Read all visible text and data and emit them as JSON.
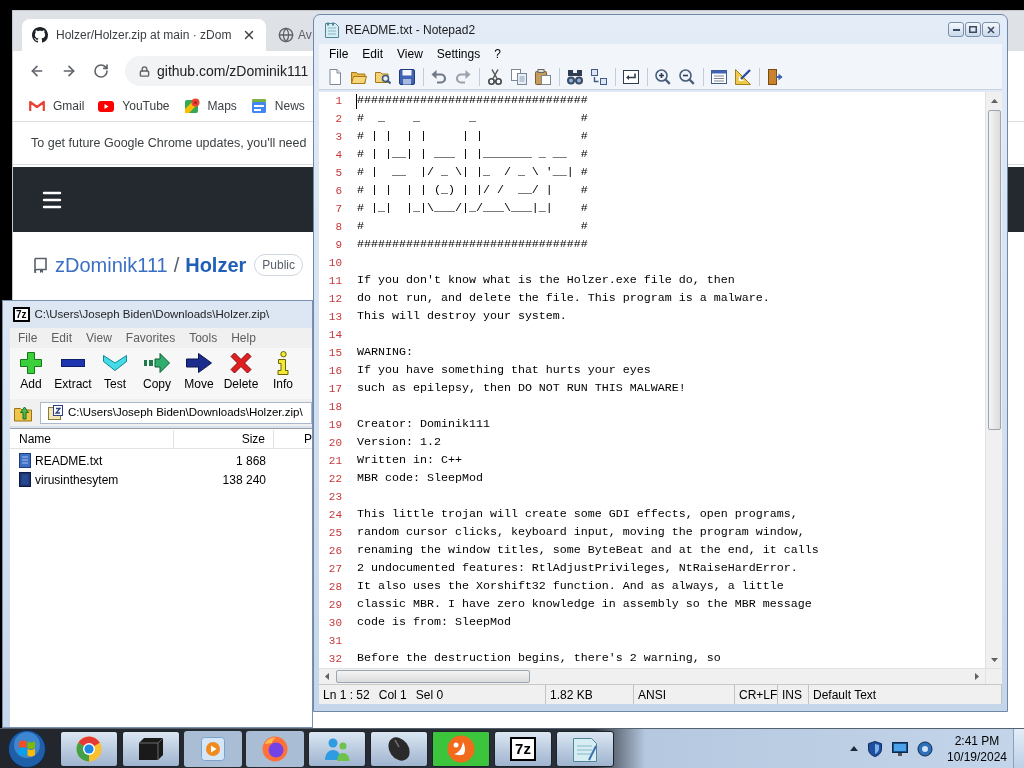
{
  "browser": {
    "tabs": [
      {
        "kind": "cat-logo",
        "title": "Holzer/Holzer.zip at main · zDom",
        "selected": true
      },
      {
        "kind": "globe",
        "title": "Av",
        "selected": false
      }
    ],
    "address": "github.com/zDominik111",
    "bookmarks": [
      {
        "kind": "mail",
        "label": "Gmail"
      },
      {
        "kind": "video",
        "label": "YouTube"
      },
      {
        "kind": "maps",
        "label": "Maps"
      },
      {
        "kind": "news",
        "label": "News"
      }
    ],
    "notice": "To get future Google Chrome updates, you'll need",
    "repo": {
      "owner": "zDominik111",
      "separator": "/",
      "name": "Holzer",
      "visibility": "Public"
    }
  },
  "archive": {
    "logo": "7z",
    "title": "C:\\Users\\Joseph Biden\\Downloads\\Holzer.zip\\",
    "menu": [
      "File",
      "Edit",
      "View",
      "Favorites",
      "Tools",
      "Help"
    ],
    "toolbar": [
      {
        "kind": "add",
        "label": "Add"
      },
      {
        "kind": "extract",
        "label": "Extract"
      },
      {
        "kind": "test",
        "label": "Test"
      },
      {
        "kind": "copy",
        "label": "Copy"
      },
      {
        "kind": "move",
        "label": "Move"
      },
      {
        "kind": "delete",
        "label": "Delete"
      },
      {
        "kind": "info",
        "label": "Info"
      }
    ],
    "path": "C:\\Users\\Joseph Biden\\Downloads\\Holzer.zip\\",
    "columns": [
      "Name",
      "Size",
      "P"
    ],
    "rows": [
      {
        "kind": "text",
        "name": "README.txt",
        "size": "1 868"
      },
      {
        "kind": "binary",
        "name": "virusinthesytem",
        "size": "138 240"
      }
    ]
  },
  "editor": {
    "title": "README.txt - Notepad2",
    "menu": [
      "File",
      "Edit",
      "View",
      "Settings",
      "?"
    ],
    "lines": [
      {
        "number": "1",
        "text": "#################################",
        "caret": true
      },
      {
        "number": "2",
        "text": "#  _    _       _               #",
        "caret": false
      },
      {
        "number": "3",
        "text": "# | |  | |     | |              #",
        "caret": false
      },
      {
        "number": "4",
        "text": "# | |__| | ___ | |_______ _ __  #",
        "caret": false
      },
      {
        "number": "5",
        "text": "# |  __  |/ _ \\| |_  / _ \\ '__| #",
        "caret": false
      },
      {
        "number": "6",
        "text": "# | |  | | (_) | |/ /  __/ |    #",
        "caret": false
      },
      {
        "number": "7",
        "text": "# |_|  |_|\\___/|_/___\\___|_|    #",
        "caret": false
      },
      {
        "number": "8",
        "text": "#                               #",
        "caret": false
      },
      {
        "number": "9",
        "text": "#################################",
        "caret": false
      },
      {
        "number": "10",
        "caret": false
      },
      {
        "number": "11",
        "text": "If you don't know what is the Holzer.exe file do, then",
        "caret": false
      },
      {
        "number": "12",
        "text": "do not run, and delete the file. This program is a malware.",
        "caret": false
      },
      {
        "number": "13",
        "text": "This will destroy your system.",
        "caret": false
      },
      {
        "number": "14",
        "caret": false
      },
      {
        "number": "15",
        "text": "WARNING:",
        "caret": false
      },
      {
        "number": "16",
        "text": "If you have something that hurts your eyes",
        "caret": false
      },
      {
        "number": "17",
        "text": "such as epilepsy, then DO NOT RUN THIS MALWARE!",
        "caret": false
      },
      {
        "number": "18",
        "caret": false
      },
      {
        "number": "19",
        "text": "Creator: Dominik111",
        "caret": false
      },
      {
        "number": "20",
        "text": "Version: 1.2",
        "caret": false
      },
      {
        "number": "21",
        "text": "Written in: C++",
        "caret": false
      },
      {
        "number": "22",
        "text": "MBR code: SleepMod",
        "caret": false
      },
      {
        "number": "23",
        "caret": false
      },
      {
        "number": "24",
        "text": "This little trojan will create some GDI effects, open programs,",
        "caret": false
      },
      {
        "number": "25",
        "text": "random cursor clicks, keyboard input, moving the program window,",
        "caret": false
      },
      {
        "number": "26",
        "text": "renaming the window titles, some ByteBeat and at the end, it calls",
        "caret": false
      },
      {
        "number": "27",
        "text": "2 undocumented features: RtlAdjustPrivileges, NtRaiseHardError.",
        "caret": false
      },
      {
        "number": "28",
        "text": "It also uses the Xorshift32 function. And as always, a little",
        "caret": false
      },
      {
        "number": "29",
        "text": "classic MBR. I have zero knowledge in assembly so the MBR message",
        "caret": false
      },
      {
        "number": "30",
        "text": "code is from: SleepMod",
        "caret": false
      },
      {
        "number": "31",
        "caret": false
      },
      {
        "number": "32",
        "text": "Before the destruction begins, there's 2 warning, so",
        "caret": false
      }
    ],
    "status_bar": [
      {
        "texts": [
          "Ln 1 : 52",
          "Col 1",
          "Sel 0"
        ]
      },
      {
        "texts": [
          "1.82 KB"
        ]
      },
      {
        "texts": [
          "ANSI"
        ]
      },
      {
        "texts": [
          "CR+LF"
        ]
      },
      {
        "texts": [
          "INS"
        ]
      },
      {
        "texts": [
          "Default Text"
        ]
      }
    ]
  },
  "taskbar": {
    "apps": [
      {
        "kind": "browser",
        "running": true
      },
      {
        "kind": "device",
        "running": true
      },
      {
        "kind": "media",
        "running": false
      },
      {
        "kind": "fox",
        "running": false
      },
      {
        "kind": "people",
        "running": true
      },
      {
        "kind": "mouse",
        "running": true
      },
      {
        "kind": "swirl",
        "running": true,
        "level": 1
      },
      {
        "kind": "archiver",
        "label": "7z",
        "running": true
      },
      {
        "kind": "notepad",
        "running": true
      }
    ],
    "time": "2:41 PM",
    "date": "10/19/2024"
  }
}
